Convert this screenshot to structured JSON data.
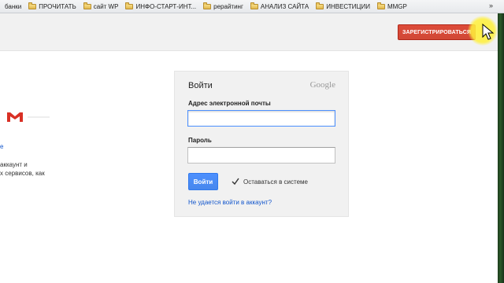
{
  "bookmarks_bar": {
    "items": [
      {
        "label": "банки"
      },
      {
        "label": "ПРОЧИТАТЬ"
      },
      {
        "label": "сайт WP"
      },
      {
        "label": "ИНФО-СТАРТ-ИНТ..."
      },
      {
        "label": "рерайтинг"
      },
      {
        "label": "АНАЛИЗ САЙТА"
      },
      {
        "label": "ИНВЕСТИЦИИ"
      },
      {
        "label": "MMGP"
      }
    ],
    "overflow_label": "»"
  },
  "header": {
    "register_label": "ЗАРЕГИСТРИРОВАТЬСЯ"
  },
  "left_panel": {
    "line1": "е",
    "line2": "аккаунт и",
    "line3": "х сервисов, как"
  },
  "login": {
    "title": "Войти",
    "brand": "Google",
    "email_label": "Адрес электронной почты",
    "email_value": "",
    "password_label": "Пароль",
    "password_value": "",
    "signin_label": "Войти",
    "stay_signed_in_label": "Оставаться в системе",
    "stay_signed_in_checked": true,
    "help_link": "Не удается войти в аккаунт?"
  },
  "colors": {
    "register_red": "#d14836",
    "signin_blue": "#4d90fe",
    "link_blue": "#1155cc",
    "box_bg": "#f1f1f1"
  },
  "icons": [
    "folder-icon",
    "gmail-logo",
    "checkmark-icon",
    "mouse-cursor-icon"
  ]
}
